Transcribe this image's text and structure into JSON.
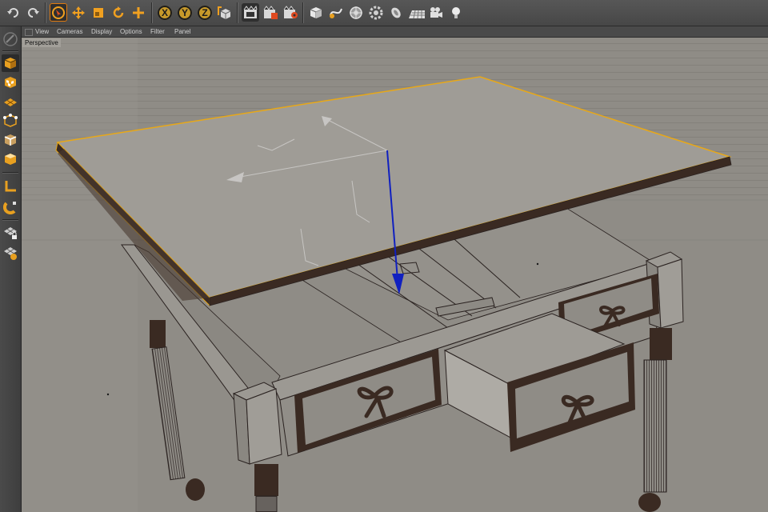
{
  "viewport": {
    "menu": [
      {
        "label": "View"
      },
      {
        "label": "Cameras"
      },
      {
        "label": "Display"
      },
      {
        "label": "Options"
      },
      {
        "label": "Filter"
      },
      {
        "label": "Panel"
      }
    ],
    "projection_label": "Perspective"
  },
  "toolbar": {
    "axis_x": "X",
    "axis_y": "Y",
    "axis_z": "Z"
  },
  "colors": {
    "accent": "#f0a020",
    "selection_outline": "#e8a818",
    "viewport_bg": "#8f8c86",
    "axis_y_arrow": "#1020c0",
    "wood_dark": "#3a2a22"
  },
  "icons": {
    "toolbar": [
      "undo-icon",
      "redo-icon",
      "live-select-icon",
      "move-icon",
      "scale-icon",
      "rotate-icon",
      "add-icon",
      "x-axis-lock-icon",
      "y-axis-lock-icon",
      "z-axis-lock-icon",
      "coordinate-system-icon",
      "render-view-icon",
      "render-picture-viewer-icon",
      "render-settings-icon",
      "cube-primitive-icon",
      "spline-pen-icon",
      "nurbs-generator-icon",
      "array-modeling-icon",
      "deformer-icon",
      "floor-environment-icon",
      "camera-icon",
      "light-icon"
    ],
    "leftbar": [
      "make-editable-icon",
      "model-mode-icon",
      "texture-mode-icon",
      "points-mode-icon",
      "edges-mode-icon",
      "polygons-mode-icon",
      "workplane-icon",
      "snapping-icon",
      "locked-workplane-icon",
      "planar-workplane-icon"
    ]
  }
}
